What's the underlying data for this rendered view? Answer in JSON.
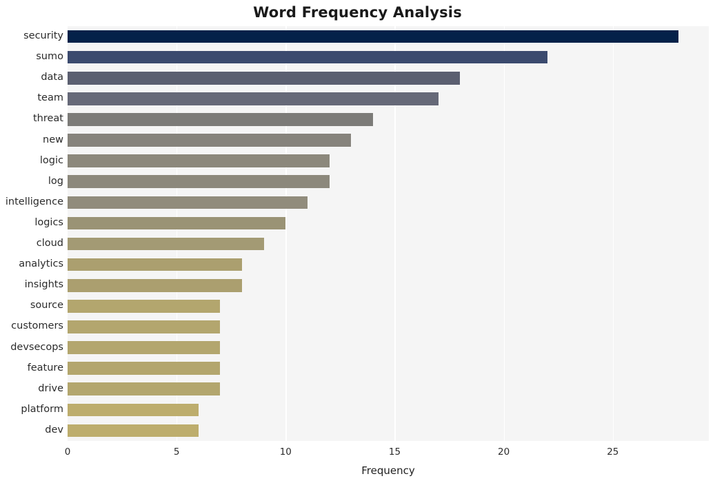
{
  "chart_data": {
    "type": "bar",
    "orientation": "horizontal",
    "title": "Word Frequency Analysis",
    "xlabel": "Frequency",
    "ylabel": "",
    "categories": [
      "security",
      "sumo",
      "data",
      "team",
      "threat",
      "new",
      "logic",
      "log",
      "intelligence",
      "logics",
      "cloud",
      "analytics",
      "insights",
      "source",
      "customers",
      "devsecops",
      "feature",
      "drive",
      "platform",
      "dev"
    ],
    "values": [
      28,
      22,
      18,
      17,
      14,
      13,
      12,
      12,
      11,
      10,
      9,
      8,
      8,
      7,
      7,
      7,
      7,
      7,
      6,
      6
    ],
    "bar_colors": [
      "#042149",
      "#3b4a6e",
      "#5b5f70",
      "#666978",
      "#7c7b78",
      "#86837c",
      "#8c887c",
      "#8c887c",
      "#918c7c",
      "#9a9375",
      "#a39a74",
      "#ab9f6f",
      "#ab9f6f",
      "#b3a66e",
      "#b3a66e",
      "#b3a66e",
      "#b3a66e",
      "#b3a66e",
      "#bdad6d",
      "#bdad6d"
    ],
    "xlim": [
      0,
      29.4
    ],
    "xticks": [
      0,
      5,
      10,
      15,
      20,
      25
    ],
    "xticklabels": [
      "0",
      "5",
      "10",
      "15",
      "20",
      "25"
    ],
    "grid": true,
    "grid_color": "#ffffff",
    "plot_background": "#f5f5f5",
    "figure_background": "#ffffff",
    "legend": null
  }
}
